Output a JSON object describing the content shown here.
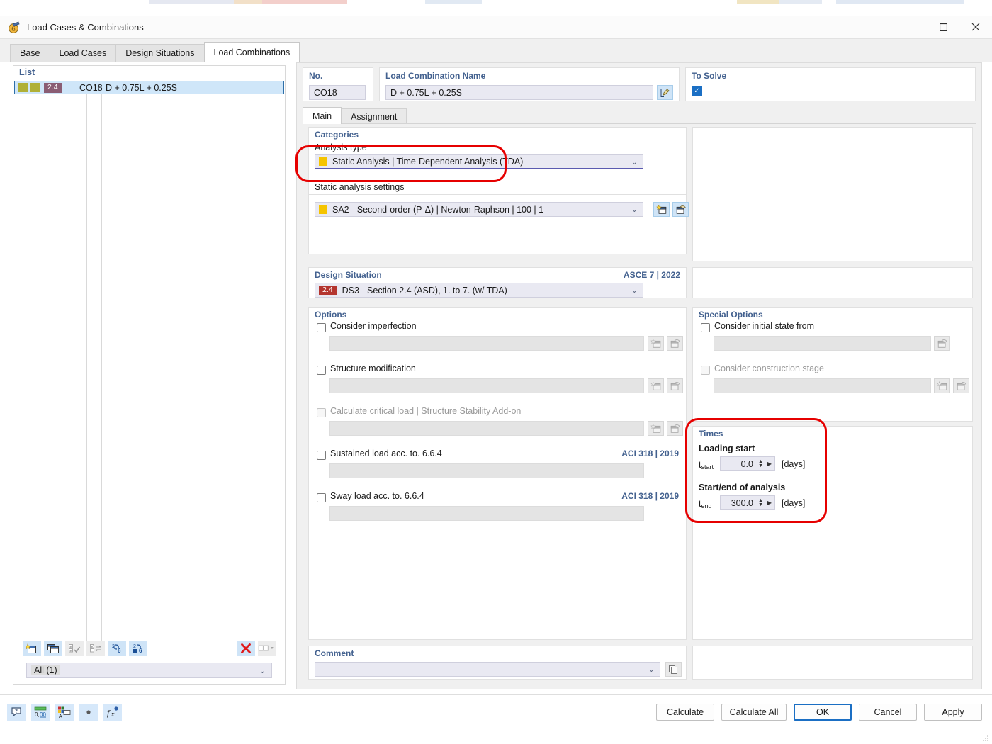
{
  "window": {
    "title": "Load Cases & Combinations",
    "icon": "app-icon",
    "minimize": "—",
    "maximize": "▢",
    "close": "✕"
  },
  "tabs": [
    {
      "label": "Base",
      "active": false
    },
    {
      "label": "Load Cases",
      "active": false
    },
    {
      "label": "Design Situations",
      "active": false
    },
    {
      "label": "Load Combinations",
      "active": true
    }
  ],
  "list": {
    "header": "List",
    "rows": [
      {
        "no": "CO18",
        "name": "D + 0.75L + 0.25S",
        "badge": "2.4",
        "selected": true
      }
    ],
    "toolbar": [
      {
        "name": "new-icon",
        "enabled": true
      },
      {
        "name": "copy-icon",
        "enabled": true
      },
      {
        "name": "select-all-icon",
        "enabled": false
      },
      {
        "name": "invert-selection-icon",
        "enabled": false
      },
      {
        "name": "renumber-icon",
        "enabled": true
      },
      {
        "name": "renumber-from-icon",
        "enabled": true
      },
      {
        "name": "delete-icon",
        "enabled": true
      },
      {
        "name": "columns-icon",
        "enabled": false
      }
    ],
    "filter": {
      "label": "All (1)",
      "chevron": "⌄"
    }
  },
  "header": {
    "no_caption": "No.",
    "no_value": "CO18",
    "name_caption": "Load Combination Name",
    "name_value": "D + 0.75L + 0.25S",
    "edit_icon": "edit-name-icon",
    "solve_caption": "To Solve",
    "solve_checked": true,
    "solve_check_glyph": "✓"
  },
  "inner_tabs": [
    {
      "label": "Main",
      "active": true
    },
    {
      "label": "Assignment",
      "active": false
    }
  ],
  "categories": {
    "title": "Categories",
    "analysis_type_label": "Analysis type",
    "analysis_type_value": "Static Analysis | Time-Dependent Analysis (TDA)",
    "static_settings_label": "Static analysis settings",
    "static_settings_value": "SA2 - Second-order (P-Δ) | Newton-Raphson | 100 | 1",
    "chevron": "⌄",
    "new_icon": "new-icon",
    "edit_icon": "edit-icon"
  },
  "design_situation": {
    "title": "Design Situation",
    "standard": "ASCE 7 | 2022",
    "badge": "2.4",
    "value": "DS3 - Section 2.4 (ASD), 1. to 7. (w/ TDA)",
    "chevron": "⌄"
  },
  "options": {
    "title": "Options",
    "items": [
      {
        "label": "Consider imperfection",
        "checked": false,
        "disabled": false,
        "has_buttons": true,
        "note": ""
      },
      {
        "label": "Structure modification",
        "checked": false,
        "disabled": false,
        "has_buttons": true,
        "note": ""
      },
      {
        "label": "Calculate critical load | Structure Stability Add-on",
        "checked": false,
        "disabled": true,
        "has_buttons": true,
        "note": ""
      },
      {
        "label": "Sustained load acc. to. 6.6.4",
        "checked": false,
        "disabled": false,
        "has_buttons": false,
        "note": "ACI 318 | 2019"
      },
      {
        "label": "Sway load acc. to. 6.6.4",
        "checked": false,
        "disabled": false,
        "has_buttons": false,
        "note": "ACI 318 | 2019"
      }
    ]
  },
  "special_options": {
    "title": "Special Options",
    "items": [
      {
        "label": "Consider initial state from",
        "checked": false,
        "disabled": false,
        "buttons": 1
      },
      {
        "label": "Consider construction stage",
        "checked": false,
        "disabled": true,
        "buttons": 2
      }
    ]
  },
  "times": {
    "title": "Times",
    "loading_start_label": "Loading start",
    "t_start_symbol": "t",
    "t_start_sub": "start",
    "t_start_value": "0.0",
    "t_start_unit": "[days]",
    "analysis_label": "Start/end of analysis",
    "t_end_symbol": "t",
    "t_end_sub": "end",
    "t_end_value": "300.0",
    "t_end_unit": "[days]"
  },
  "comment": {
    "title": "Comment",
    "value": "",
    "chevron": "⌄",
    "copy_icon": "copy-comment-icon"
  },
  "bottom": {
    "tools": [
      {
        "name": "help-icon"
      },
      {
        "name": "decimal-places-icon"
      },
      {
        "name": "display-properties-icon"
      },
      {
        "name": "dot-icon"
      },
      {
        "name": "formula-icon"
      }
    ],
    "buttons": [
      {
        "label": "Calculate",
        "primary": false
      },
      {
        "label": "Calculate All",
        "primary": false
      },
      {
        "label": "OK",
        "primary": true
      },
      {
        "label": "Cancel",
        "primary": false
      },
      {
        "label": "Apply",
        "primary": false
      }
    ]
  },
  "annotations": {
    "ring_analysis_type": "highlight-analysis-type",
    "ring_times": "highlight-times"
  },
  "colors": {
    "accent_blue": "#1b6fc4",
    "caption_blue": "#43618f",
    "highlight_red": "#e60000",
    "badge_red": "#b4352f",
    "badge_mauve": "#8a5d74",
    "swatch_olive": "#b0b037",
    "swatch_yellow": "#f5c400"
  }
}
